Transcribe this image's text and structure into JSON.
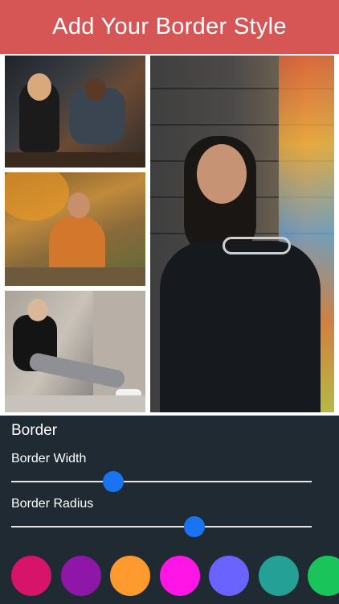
{
  "header": {
    "title": "Add Your Border Style",
    "color": "#d65656"
  },
  "collage": {
    "photos": [
      {
        "name": "friends-toasting-photo"
      },
      {
        "name": "woman-floral-dress-photo"
      },
      {
        "name": "man-sitting-sneakers-photo"
      },
      {
        "name": "woman-holding-sunglasses-photo"
      }
    ]
  },
  "panel": {
    "title": "Border",
    "border_width": {
      "label": "Border Width",
      "value_fraction": 0.34
    },
    "border_radius": {
      "label": "Border Radius",
      "value_fraction": 0.61
    },
    "slider_accent": "#1a73f0"
  },
  "colors": [
    "#d6146a",
    "#8e17a8",
    "#ff9a2e",
    "#ff15e6",
    "#6a63ff",
    "#24a096",
    "#19c45a"
  ]
}
